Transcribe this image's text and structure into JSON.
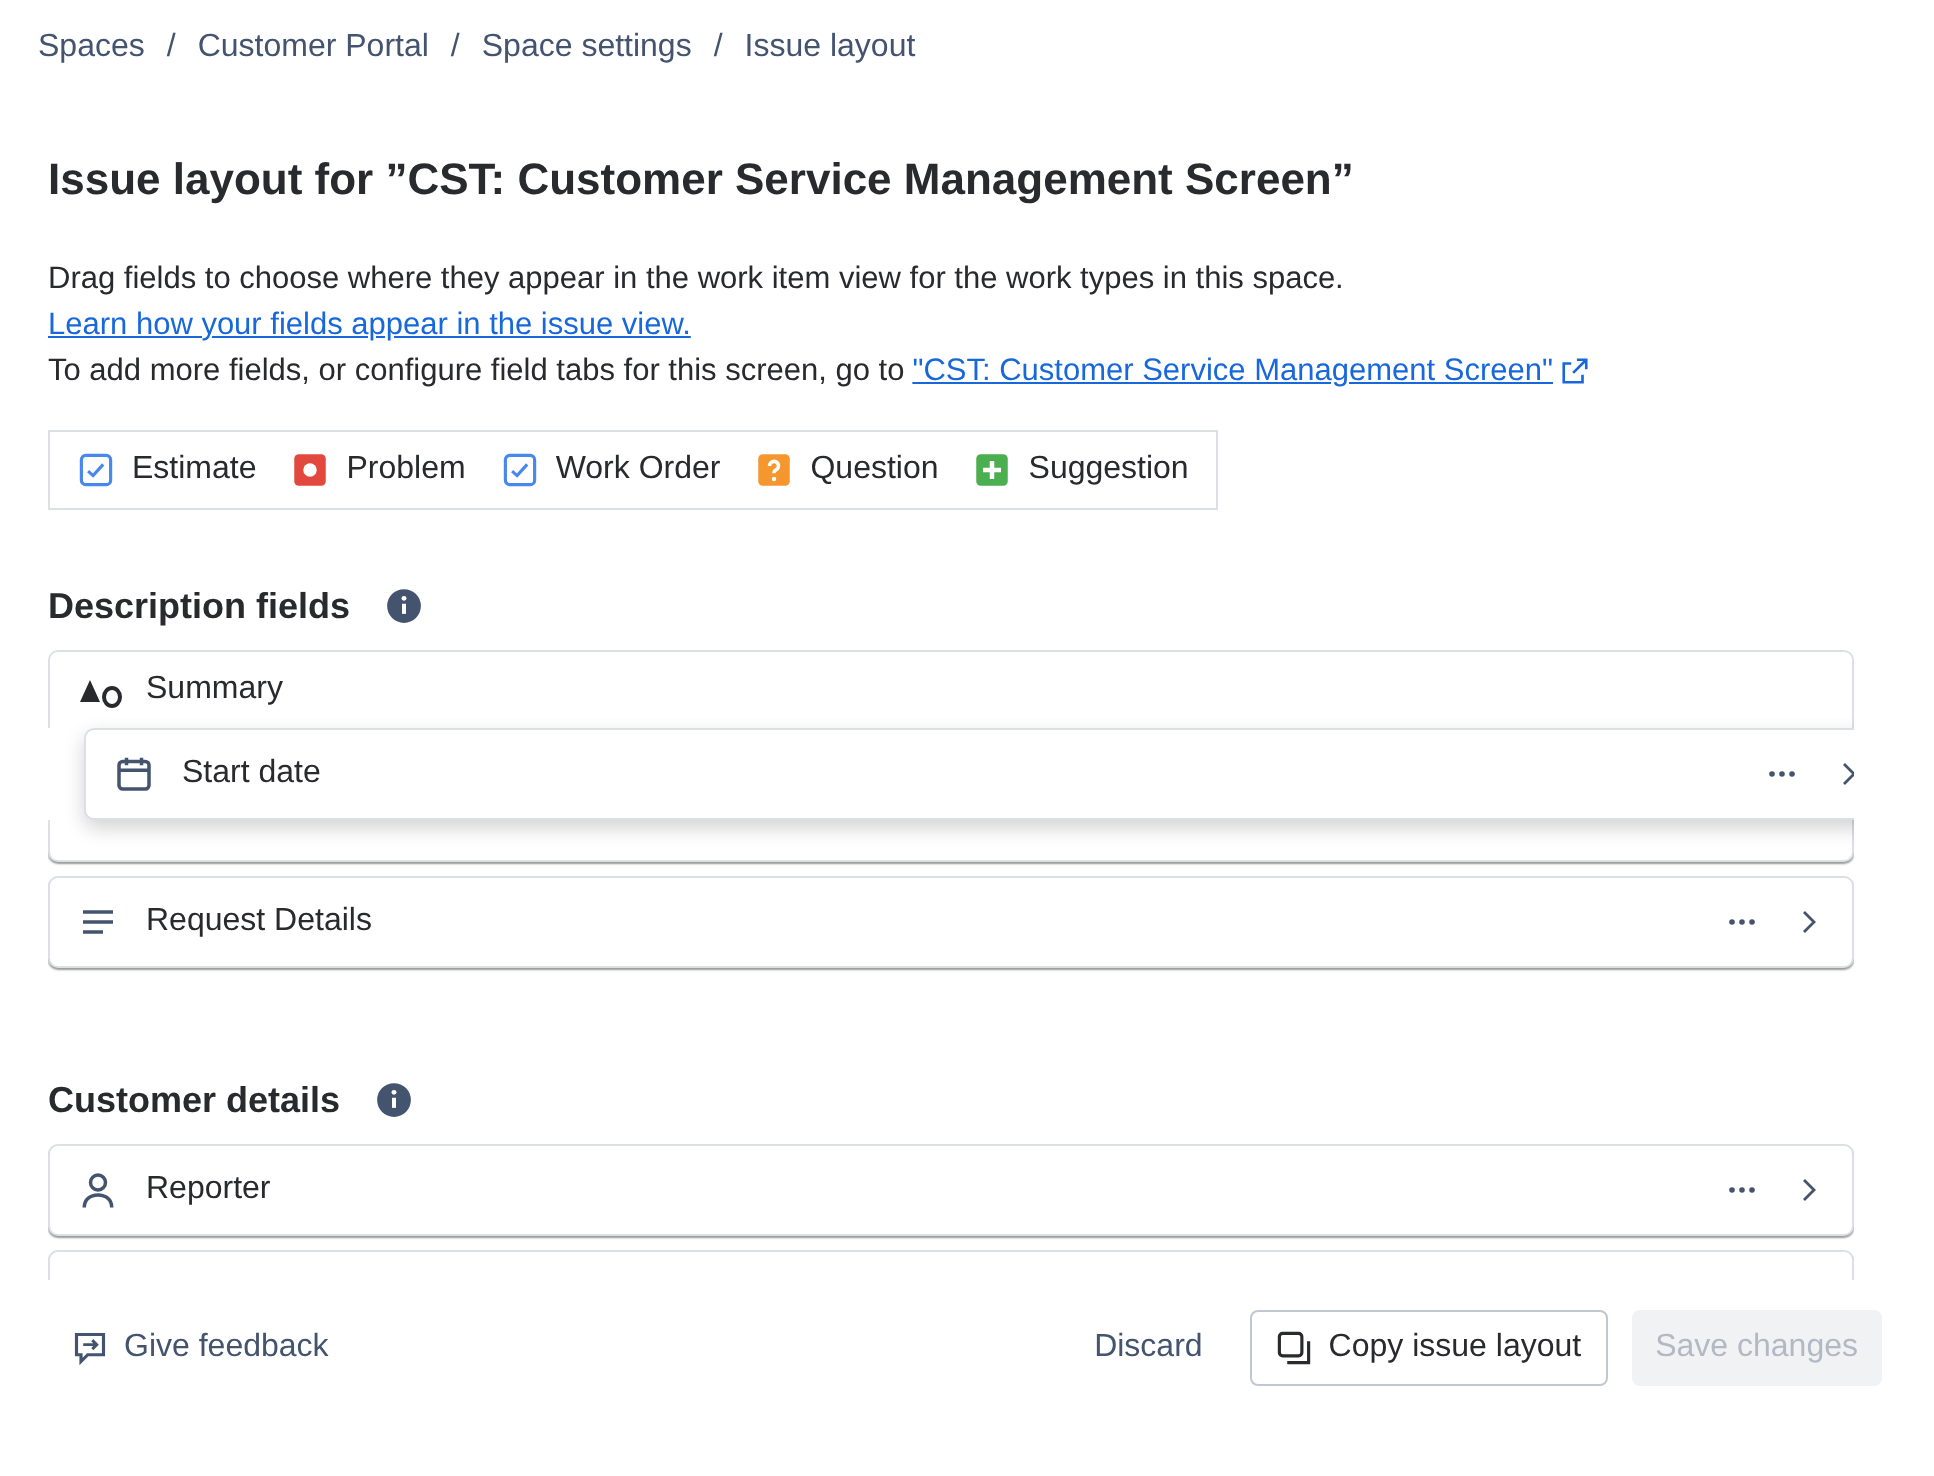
{
  "breadcrumbs": [
    {
      "label": "Spaces"
    },
    {
      "separator": "/",
      "label": "Customer Portal"
    },
    {
      "separator": "/",
      "label": "Space settings"
    },
    {
      "separator": "/",
      "label": "Issue layout"
    }
  ],
  "title": "Issue layout for ”CST: Customer Service Management Screen”",
  "intro": {
    "line_1": "Drag fields to choose where they appear in the work item view for the work types in this space.",
    "learn_link": "Learn how your fields appear in the issue view.",
    "line_3": "To add more fields, or configure field tabs for this screen, go to",
    "screen_link": "\"CST: Customer Service Management Screen\""
  },
  "work_types": [
    {
      "label": "Estimate",
      "kind": "check",
      "color": "#4688ec"
    },
    {
      "label": "Problem",
      "kind": "stop",
      "color": "#e2483d"
    },
    {
      "label": "Work Order",
      "kind": "check",
      "color": "#4688ec"
    },
    {
      "label": "Question",
      "kind": "question",
      "color": "#f5962e"
    },
    {
      "label": "Suggestion",
      "kind": "plus",
      "color": "#4bae4f"
    }
  ],
  "sections": [
    {
      "title": "Description fields",
      "fields": [
        {
          "kind": "text",
          "label": "Summary",
          "actions": false,
          "dragging": false,
          "covered": false
        },
        {
          "kind": "calendar",
          "label": "Start date",
          "actions": true,
          "dragging": true,
          "covered": false
        },
        {
          "dragging": false,
          "covered": true
        },
        {
          "kind": "lines",
          "label": "Request Details",
          "actions": true,
          "dragging": false,
          "covered": false
        }
      ]
    },
    {
      "title": "Customer details",
      "fields": [
        {
          "kind": "person",
          "label": "Reporter",
          "actions": true,
          "dragging": false,
          "covered": false
        },
        {
          "kind": "blank",
          "dragging": false,
          "covered": false
        }
      ]
    }
  ],
  "footer": {
    "feedback": "Give feedback",
    "discard": "Discard",
    "copy": "Copy issue layout",
    "save": {
      "label": "Save changes",
      "disabled": true
    }
  }
}
